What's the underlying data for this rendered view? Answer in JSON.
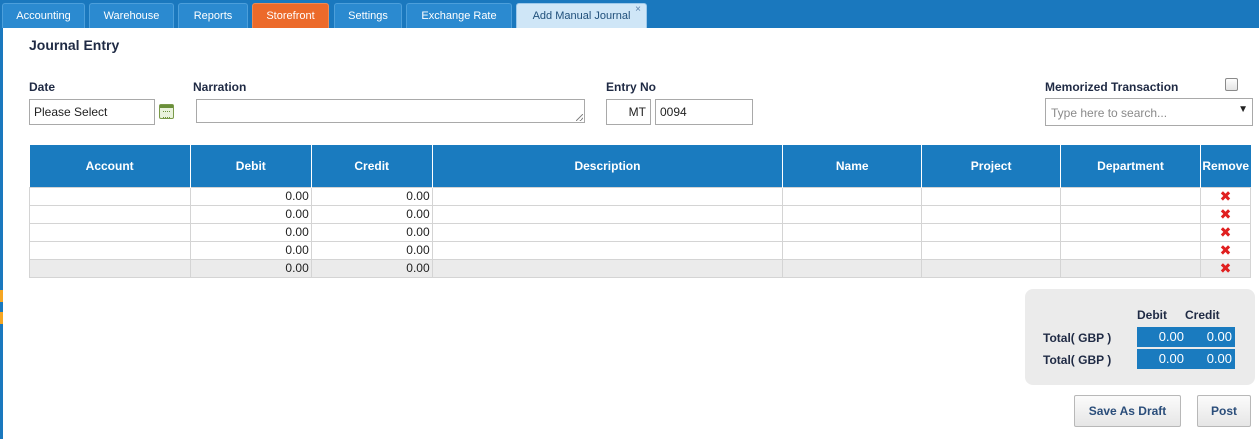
{
  "tabs": [
    {
      "label": "Accounting"
    },
    {
      "label": "Warehouse"
    },
    {
      "label": "Reports"
    },
    {
      "label": "Storefront"
    },
    {
      "label": "Settings"
    },
    {
      "label": "Exchange Rate"
    },
    {
      "label": "Add Manual Journal",
      "close": "×"
    }
  ],
  "page_title": "Journal Entry",
  "form": {
    "date_label": "Date",
    "date_value": "Please Select",
    "narration_label": "Narration",
    "narration_value": "",
    "entry_no_label": "Entry No",
    "entry_prefix": "MT",
    "entry_number": "0094",
    "memorized_label": "Memorized Transaction",
    "memorized_checked": false,
    "memorized_placeholder": "Type here to search...",
    "memorized_arrow": "▼"
  },
  "grid": {
    "columns": [
      "Account",
      "Debit",
      "Credit",
      "Description",
      "Name",
      "Project",
      "Department",
      "Remove"
    ],
    "rows": [
      {
        "account": "",
        "debit": "0.00",
        "credit": "0.00",
        "description": "",
        "name": "",
        "project": "",
        "department": "",
        "remove": "✖"
      },
      {
        "account": "",
        "debit": "0.00",
        "credit": "0.00",
        "description": "",
        "name": "",
        "project": "",
        "department": "",
        "remove": "✖"
      },
      {
        "account": "",
        "debit": "0.00",
        "credit": "0.00",
        "description": "",
        "name": "",
        "project": "",
        "department": "",
        "remove": "✖"
      },
      {
        "account": "",
        "debit": "0.00",
        "credit": "0.00",
        "description": "",
        "name": "",
        "project": "",
        "department": "",
        "remove": "✖"
      },
      {
        "account": "",
        "debit": "0.00",
        "credit": "0.00",
        "description": "",
        "name": "",
        "project": "",
        "department": "",
        "remove": "✖"
      }
    ]
  },
  "totals": {
    "debit_header": "Debit",
    "credit_header": "Credit",
    "rows": [
      {
        "label": "Total( GBP )",
        "debit": "0.00",
        "credit": "0.00"
      },
      {
        "label": "Total( GBP )",
        "debit": "0.00",
        "credit": "0.00"
      }
    ]
  },
  "actions": {
    "save_draft": "Save As Draft",
    "post": "Post"
  },
  "colors": {
    "brand_blue": "#1a78be",
    "storefront_orange": "#ec6a2a",
    "remove_red": "#e02020"
  },
  "icons": {
    "calendar": "calendar-icon",
    "remove": "remove-icon",
    "tab_close": "close-icon"
  }
}
